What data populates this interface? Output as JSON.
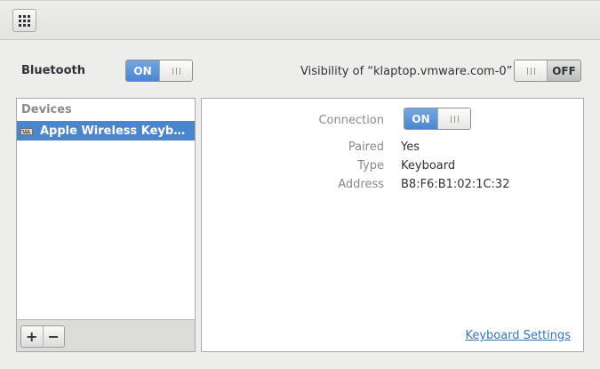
{
  "toolbar": {
    "grid_icon": "grid-icon"
  },
  "bluetooth": {
    "label": "Bluetooth",
    "switch_on": "ON",
    "state": "on"
  },
  "visibility": {
    "label": "Visibility of “klaptop.vmware.com-0”",
    "switch_off": "OFF",
    "state": "off"
  },
  "devices": {
    "header": "Devices",
    "items": [
      {
        "label": "Apple Wireless Keyb…",
        "icon": "keyboard-icon",
        "selected": true
      }
    ],
    "add_label": "+",
    "remove_label": "−"
  },
  "details": {
    "connection_label": "Connection",
    "connection_switch": "ON",
    "paired_label": "Paired",
    "paired_value": "Yes",
    "type_label": "Type",
    "type_value": "Keyboard",
    "address_label": "Address",
    "address_value": "B8:F6:B1:02:1C:32",
    "keyboard_settings_link": "Keyboard Settings"
  },
  "colors": {
    "accent": "#4a86cf",
    "link": "#3b73b9"
  }
}
